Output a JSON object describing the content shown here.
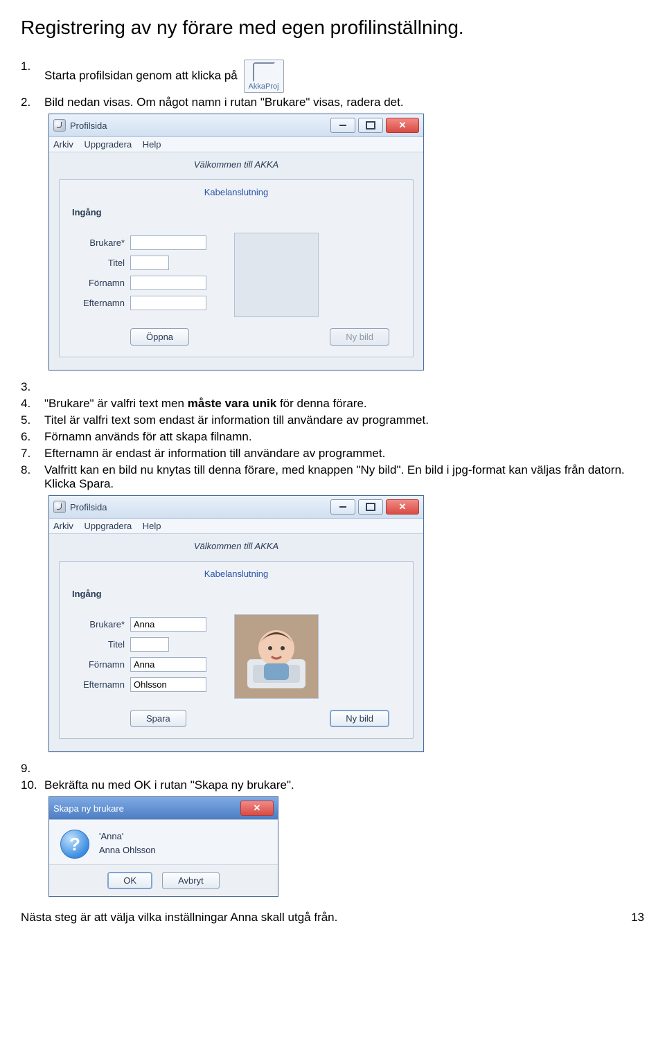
{
  "doc": {
    "heading": "Registrering av ny förare med egen profilinställning.",
    "footer_text": "Nästa steg är att välja vilka inställningar Anna skall utgå från.",
    "page_number": "13"
  },
  "icon": {
    "label": "AkkaProj"
  },
  "steps": {
    "s1": "Starta profilsidan genom att klicka på",
    "s2": "Bild nedan visas. Om något namn i rutan \"Brukare\" visas, radera det.",
    "s4a": "\"Brukare\" är valfri text men ",
    "s4b": "måste vara unik",
    "s4c": " för denna förare.",
    "s5": "Titel är valfri text som endast är information till användare av programmet.",
    "s6": "Förnamn används för att skapa filnamn.",
    "s7": "Efternamn är endast är information till användare av programmet.",
    "s8": "Valfritt kan en bild nu knytas till denna förare, med knappen \"Ny bild\". En bild i jpg-format kan väljas från datorn. Klicka Spara.",
    "s10": "Bekräfta nu med OK i rutan \"Skapa ny brukare\"."
  },
  "win": {
    "title": "Profilsida",
    "menu": {
      "arkiv": "Arkiv",
      "uppgradera": "Uppgradera",
      "help": "Help"
    },
    "welcome": "Välkommen till AKKA",
    "link": "Kabelanslutning",
    "ingang": "Ingång",
    "labels": {
      "brukare": "Brukare*",
      "titel": "Titel",
      "fornamn": "Förnamn",
      "efternamn": "Efternamn"
    },
    "buttons": {
      "oppna": "Öppna",
      "spara": "Spara",
      "nybild": "Ny bild"
    }
  },
  "form1": {
    "brukare": "",
    "titel": "",
    "fornamn": "",
    "efternamn": ""
  },
  "form2": {
    "brukare": "Anna",
    "titel": "",
    "fornamn": "Anna",
    "efternamn": "Ohlsson"
  },
  "dlg": {
    "title": "Skapa ny brukare",
    "line1": "'Anna'",
    "line2": "Anna Ohlsson",
    "ok": "OK",
    "cancel": "Avbryt"
  }
}
